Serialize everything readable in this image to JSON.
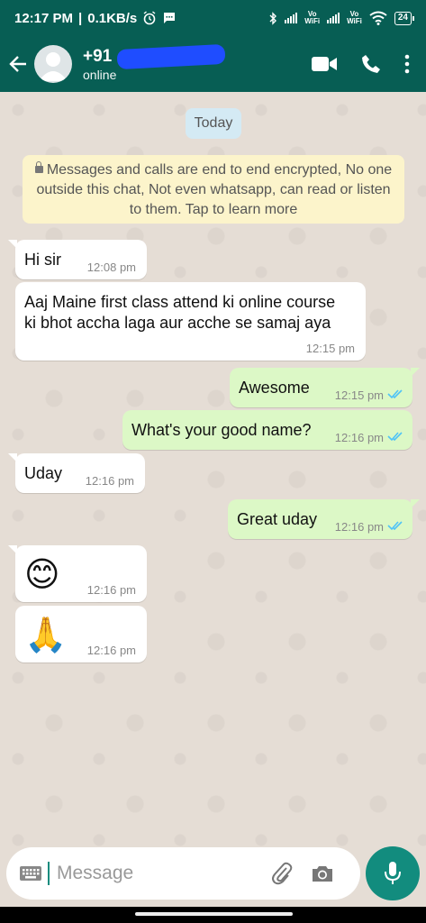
{
  "status_bar": {
    "time": "12:17 PM",
    "separator": "|",
    "network_speed": "0.1KB/s",
    "icons": [
      "alarm-icon",
      "message-icon",
      "bluetooth-icon",
      "signal-icon",
      "vowifi-icon",
      "wifi-icon"
    ],
    "vowifi_label_1": "Vo",
    "vowifi_label_2": "WiFi",
    "battery": "24"
  },
  "app_bar": {
    "contact_name": "+91",
    "contact_status": "online",
    "icons": [
      "back-arrow-icon",
      "video-call-icon",
      "phone-icon",
      "more-options-icon"
    ]
  },
  "chat": {
    "date_chip": "Today",
    "encryption_notice": "Messages and calls are end to end encrypted, No one outside this chat, Not even whatsapp, can read or listen to them. Tap to learn more",
    "messages": [
      {
        "dir": "in",
        "text": "Hi sir",
        "time": "12:08 pm"
      },
      {
        "dir": "in",
        "text": "Aaj Maine first class attend ki online course ki bhot accha laga aur acche se samaj aya",
        "time": "12:15 pm"
      },
      {
        "dir": "out",
        "text": "Awesome",
        "time": "12:15 pm",
        "status": "read"
      },
      {
        "dir": "out",
        "text": "What's your good name?",
        "time": "12:16 pm",
        "status": "read"
      },
      {
        "dir": "in",
        "text": "Uday",
        "time": "12:16 pm"
      },
      {
        "dir": "out",
        "text": "Great uday",
        "time": "12:16 pm",
        "status": "read"
      },
      {
        "dir": "in",
        "text": "😊",
        "time": "12:16 pm"
      },
      {
        "dir": "in",
        "text": "🙏",
        "time": "12:16 pm"
      }
    ]
  },
  "composer": {
    "placeholder": "Message",
    "icons": [
      "keyboard-icon",
      "attach-icon",
      "camera-icon",
      "mic-icon"
    ]
  },
  "colors": {
    "header": "#075e54",
    "chat_background": "#e5ddd5",
    "outgoing_bubble": "#dcf8c6",
    "incoming_bubble": "#ffffff",
    "read_ticks": "#4fc3f7",
    "mic_button": "#128c7e"
  }
}
